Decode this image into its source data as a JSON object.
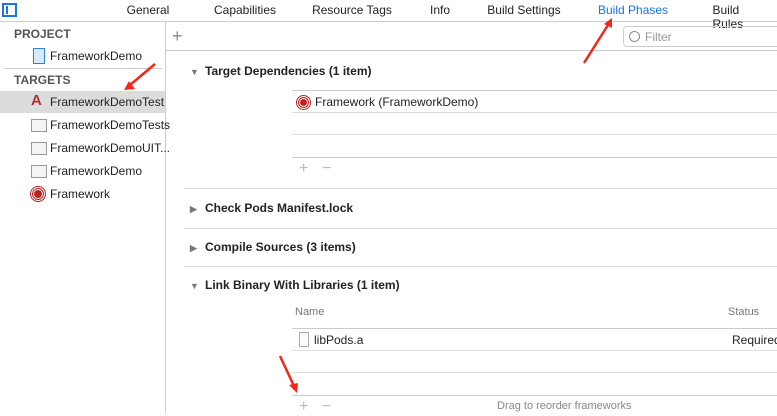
{
  "tabs": [
    {
      "label": "General",
      "active": false
    },
    {
      "label": "Capabilities",
      "active": false
    },
    {
      "label": "Resource Tags",
      "active": false
    },
    {
      "label": "Info",
      "active": false
    },
    {
      "label": "Build Settings",
      "active": false
    },
    {
      "label": "Build Phases",
      "active": true
    },
    {
      "label": "Build Rules",
      "active": false
    }
  ],
  "accent": "#1a73e8",
  "sidebar": {
    "project_header": "PROJECT",
    "project": {
      "label": "FrameworkDemo",
      "icon": "project-file-icon"
    },
    "targets_header": "TARGETS",
    "targets": [
      {
        "label": "FrameworkDemoTest",
        "icon": "app-target-icon",
        "selected": true
      },
      {
        "label": "FrameworkDemoTests",
        "icon": "bundle-icon"
      },
      {
        "label": "FrameworkDemoUIT...",
        "icon": "bundle-icon"
      },
      {
        "label": "FrameworkDemo",
        "icon": "bundle-icon"
      },
      {
        "label": "Framework",
        "icon": "framework-target-icon"
      }
    ]
  },
  "toolbar": {
    "add": "+",
    "filter_placeholder": "Filter"
  },
  "phases": {
    "target_dependencies": {
      "title": "Target Dependencies (1 item)",
      "items": [
        "Framework (FrameworkDemo)"
      ]
    },
    "check_pods": {
      "title": "Check Pods Manifest.lock"
    },
    "compile_sources": {
      "title": "Compile Sources (3 items)"
    },
    "link_binary": {
      "title": "Link Binary With Libraries (1 item)",
      "col_name": "Name",
      "col_status": "Status",
      "items": [
        {
          "name": "libPods.a",
          "status": "Required"
        }
      ],
      "hint": "Drag to reorder frameworks"
    }
  },
  "controls": {
    "plus": "+",
    "minus": "−"
  }
}
